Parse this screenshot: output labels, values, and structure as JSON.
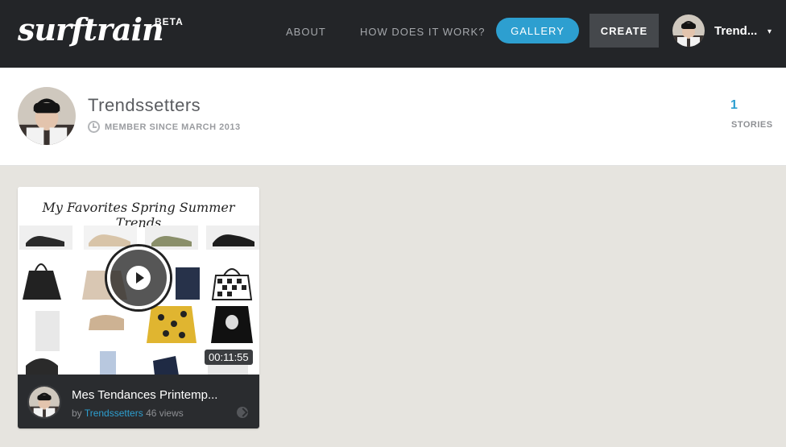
{
  "header": {
    "logo_text": "surftrain",
    "beta_label": "BETA",
    "nav": {
      "about": "ABOUT",
      "how_it_works": "HOW DOES IT WORK?",
      "gallery": "GALLERY",
      "create": "CREATE"
    },
    "user": {
      "name": "Trend...",
      "caret": "▾"
    }
  },
  "profile": {
    "name": "Trendssetters",
    "member_since": "MEMBER SINCE MARCH 2013",
    "stories_count": "1",
    "stories_label": "STORIES"
  },
  "stories": [
    {
      "thumbnail_title": "My Favorites Spring Summer Trends",
      "duration": "00:11:55",
      "title": "Mes Tendances Printemp...",
      "by_label": "by",
      "author": "Trendssetters",
      "views": "46 views"
    }
  ],
  "colors": {
    "topbar": "#232528",
    "accent": "#2d9fd0",
    "background": "#e6e4df"
  }
}
